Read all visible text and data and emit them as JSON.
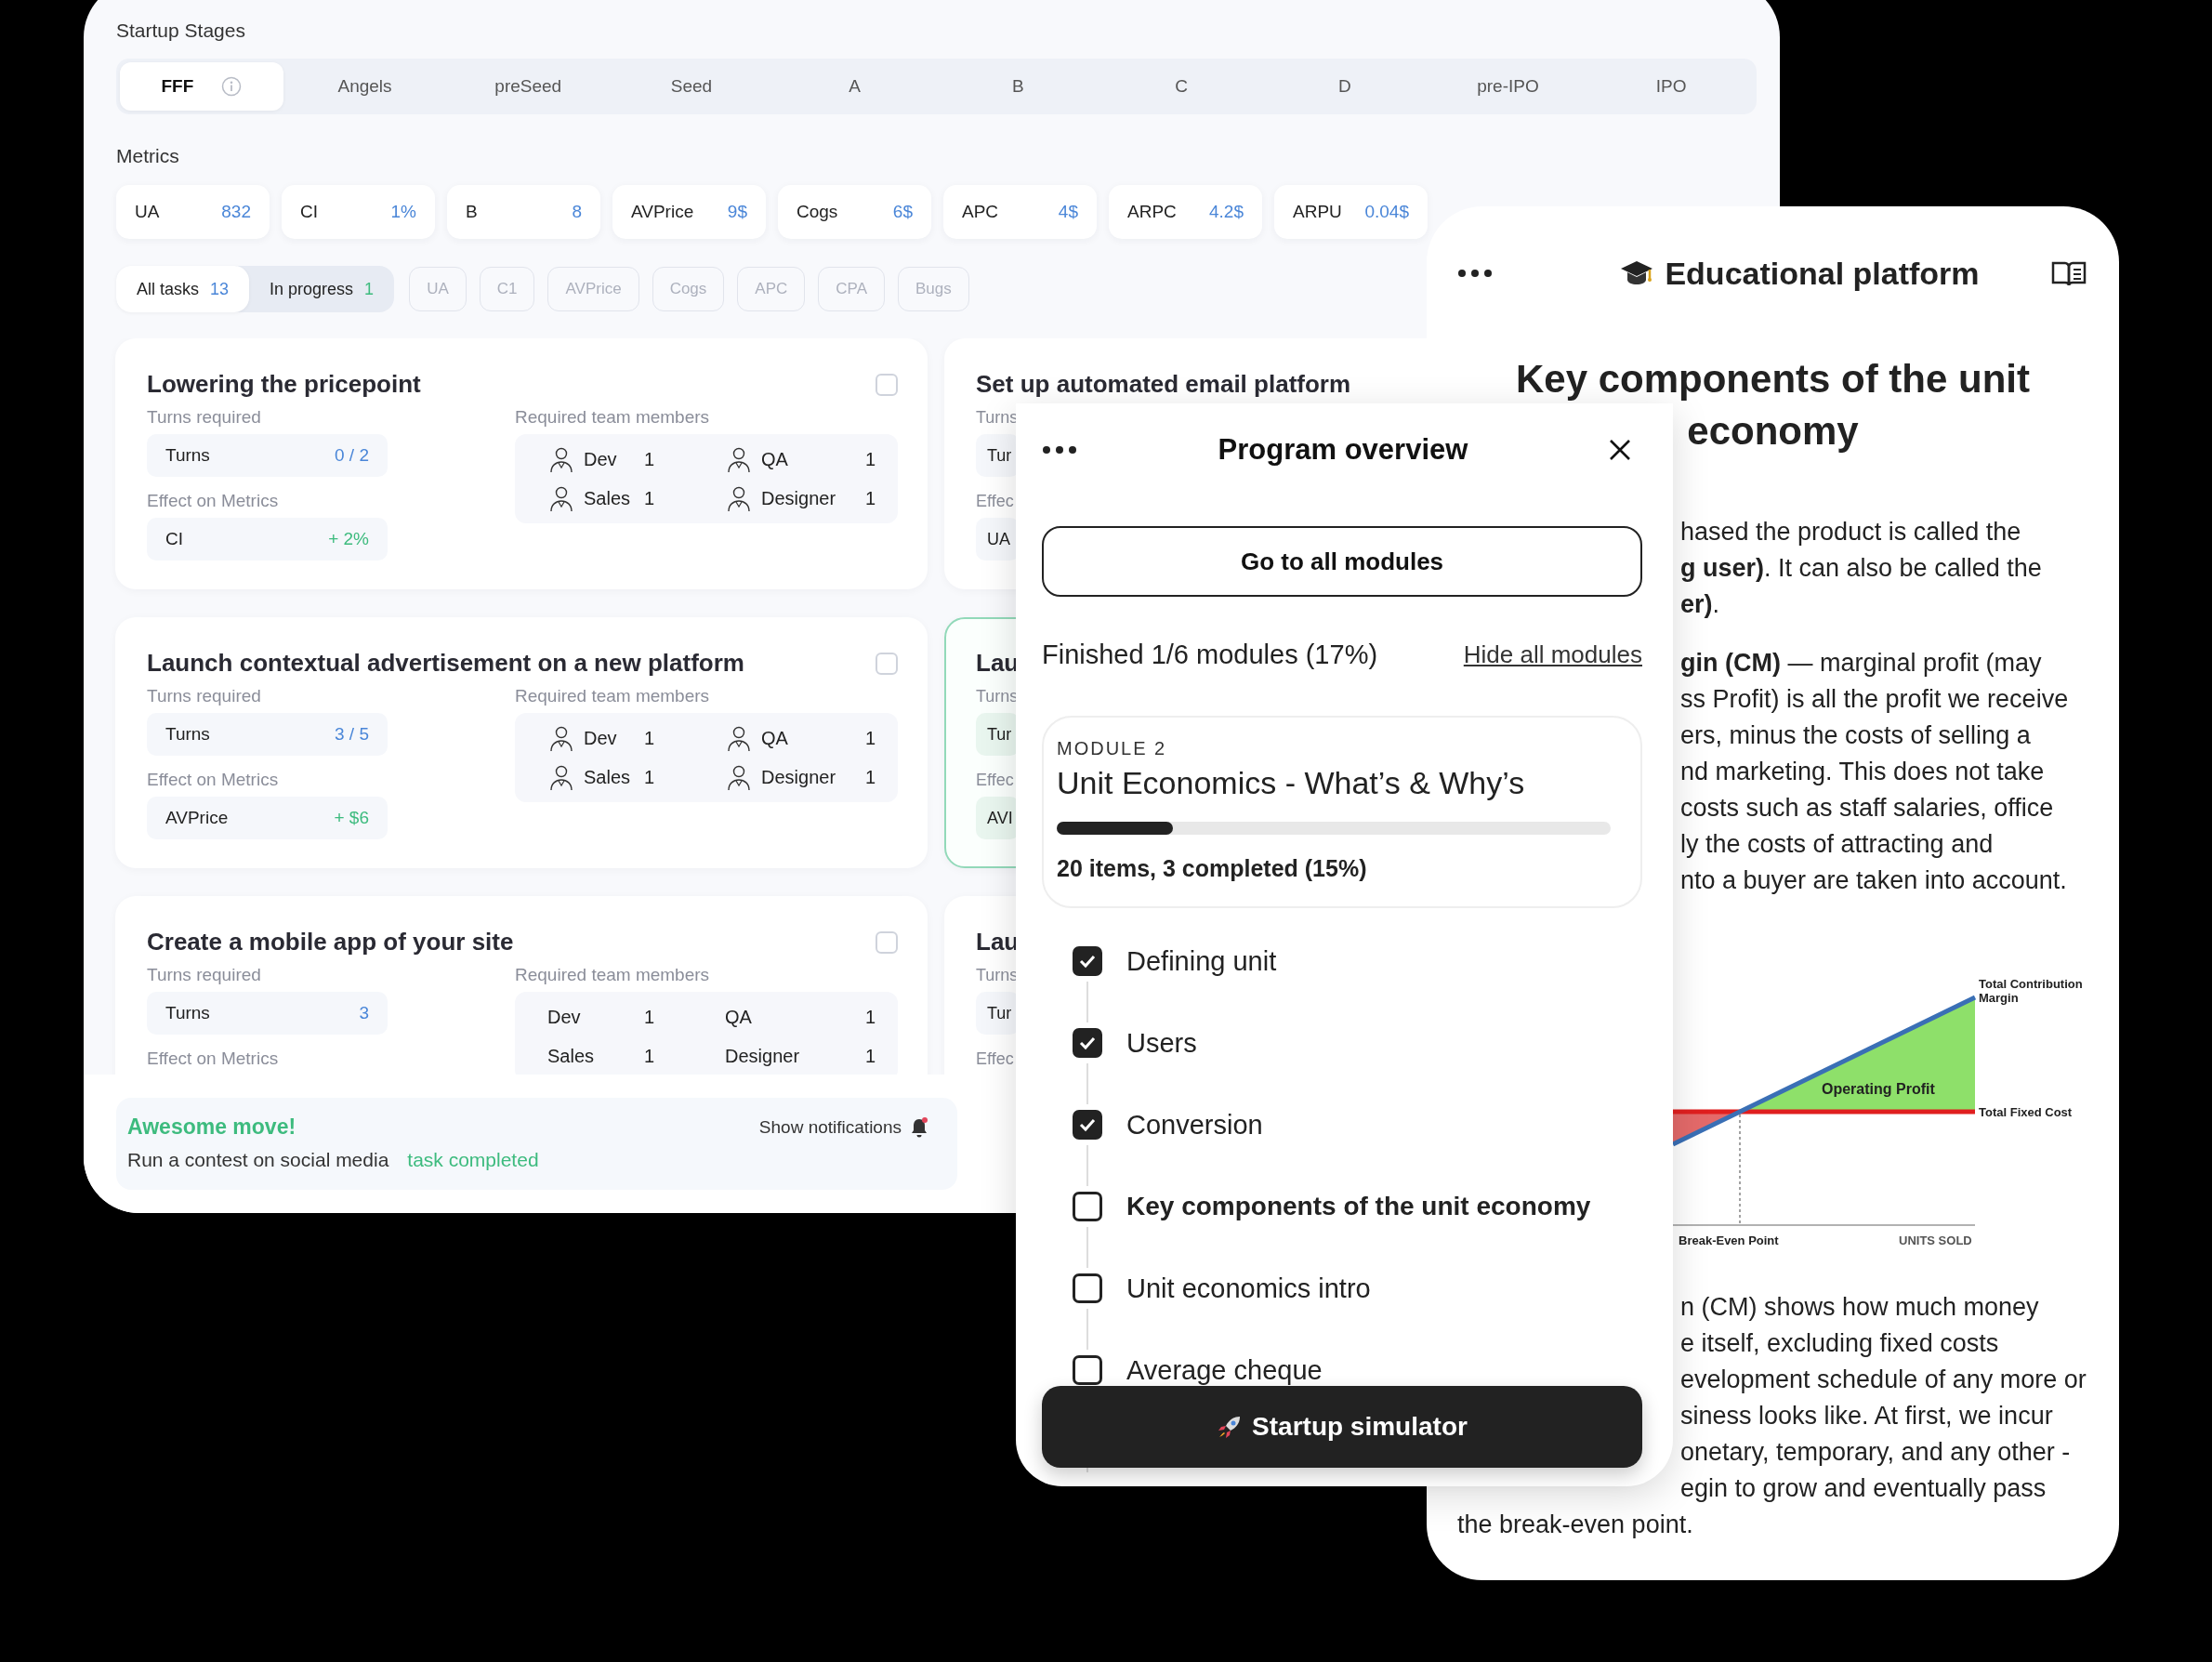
{
  "dashboard": {
    "stages_label": "Startup Stages",
    "stages": [
      {
        "label": "FFF",
        "selected": true
      },
      {
        "label": "Angels",
        "selected": false
      },
      {
        "label": "preSeed",
        "selected": false
      },
      {
        "label": "Seed",
        "selected": false
      },
      {
        "label": "A",
        "selected": false
      },
      {
        "label": "B",
        "selected": false
      },
      {
        "label": "C",
        "selected": false
      },
      {
        "label": "D",
        "selected": false
      },
      {
        "label": "pre-IPO",
        "selected": false
      },
      {
        "label": "IPO",
        "selected": false
      }
    ],
    "metrics_label": "Metrics",
    "metrics": [
      {
        "name": "UA",
        "value": "832"
      },
      {
        "name": "CI",
        "value": "1%"
      },
      {
        "name": "B",
        "value": "8"
      },
      {
        "name": "AVPrice",
        "value": "9$"
      },
      {
        "name": "Cogs",
        "value": "6$"
      },
      {
        "name": "APC",
        "value": "4$"
      },
      {
        "name": "ARPC",
        "value": "4.2$"
      },
      {
        "name": "ARPU",
        "value": "0.04$"
      }
    ],
    "filters": [
      {
        "kind": "counter",
        "label": "All tasks",
        "count": "13",
        "color": "#4a86d8",
        "selected": true
      },
      {
        "kind": "counter",
        "label": "In progress",
        "count": "1",
        "color": "#3dbb7e",
        "selected": false
      },
      {
        "kind": "tag",
        "label": "UA"
      },
      {
        "kind": "tag",
        "label": "C1"
      },
      {
        "kind": "tag",
        "label": "AVPrice"
      },
      {
        "kind": "tag",
        "label": "Cogs"
      },
      {
        "kind": "tag",
        "label": "APC"
      },
      {
        "kind": "tag",
        "label": "CPA"
      },
      {
        "kind": "tag",
        "label": "Bugs"
      }
    ],
    "tasks": [
      {
        "title": "Lowering the pricepoint",
        "checked": false,
        "highlighted": false,
        "turns_label": "Turns required",
        "turns_name": "Turns",
        "turns": "0 / 2",
        "effect_label": "Effect on Metrics",
        "metric": "CI",
        "effect": "+ 2%",
        "members_label": "Required team members",
        "members": [
          {
            "role": "Dev",
            "count": "1",
            "icon": true
          },
          {
            "role": "QA",
            "count": "1",
            "icon": true
          },
          {
            "role": "Sales",
            "count": "1",
            "icon": true
          },
          {
            "role": "Designer",
            "count": "1",
            "icon": true
          }
        ]
      },
      {
        "title": "Launch contextual advertisement on a new platform",
        "checked": false,
        "highlighted": false,
        "turns_label": "Turns required",
        "turns_name": "Turns",
        "turns": "3 / 5",
        "effect_label": "Effect on Metrics",
        "metric": "AVPrice",
        "effect": "+ $6",
        "members_label": "Required team members",
        "members": [
          {
            "role": "Dev",
            "count": "1",
            "icon": true
          },
          {
            "role": "QA",
            "count": "1",
            "icon": true
          },
          {
            "role": "Sales",
            "count": "1",
            "icon": true
          },
          {
            "role": "Designer",
            "count": "1",
            "icon": true
          }
        ]
      },
      {
        "title": "Create a mobile app of your site",
        "checked": false,
        "highlighted": false,
        "turns_label": "Turns required",
        "turns_name": "Turns",
        "turns": "3",
        "effect_label": "Effect on Metrics",
        "members_label": "Required team members",
        "members": [
          {
            "role": "Dev",
            "count": "1",
            "icon": false
          },
          {
            "role": "QA",
            "count": "1",
            "icon": false
          },
          {
            "role": "Sales",
            "count": "1",
            "icon": false
          },
          {
            "role": "Designer",
            "count": "1",
            "icon": false
          }
        ]
      }
    ],
    "tasks_right": [
      {
        "title": "Set up automated email platform",
        "highlighted": false,
        "turns_label": "Turns",
        "turns_name": "Tur",
        "effect_label": "Effec",
        "metric": "UA"
      },
      {
        "title": "Lau",
        "highlighted": true,
        "turns_label": "Turns",
        "turns_name": "Tur",
        "effect_label": "Effec",
        "metric": "AVI"
      },
      {
        "title": "Lau",
        "highlighted": false,
        "turns_label": "Turns",
        "turns_name": "Tur",
        "effect_label": "Effec"
      }
    ],
    "notification": {
      "title": "Awesome move!",
      "button": "Show notifications",
      "task": "Run a contest on social media",
      "status": "task completed"
    }
  },
  "program": {
    "title": "Program overview",
    "button": "Go to all modules",
    "progress": "Finished 1/6 modules (17%)",
    "link": "Hide all modules",
    "module": {
      "label": "MODULE 2",
      "title": "Unit Economics - What’s & Why’s",
      "level": 0.21,
      "summary": "20 items, 3 completed (15%)"
    },
    "lessons": [
      {
        "title": "Defining unit",
        "checked": true,
        "current": false
      },
      {
        "title": "Users",
        "checked": true,
        "current": false
      },
      {
        "title": "Conversion",
        "checked": true,
        "current": false
      },
      {
        "title": "Key components of the unit economy",
        "checked": false,
        "current": true
      },
      {
        "title": "Unit economics intro",
        "checked": false,
        "current": false
      },
      {
        "title": "Average cheque",
        "checked": false,
        "current": false
      }
    ],
    "action": "Startup simulator"
  },
  "education": {
    "title": "Educational platform",
    "heading": [
      "Key components of the unit",
      "economy"
    ],
    "paragraphs_top": [
      [
        "hased the product is called the",
        "**g user)**. It can also be called the",
        "**er)**."
      ],
      [
        "**gin (CM)** — marginal profit (may",
        "ss Profit) is all the profit we receive",
        "ers, minus the costs of selling a",
        "nd marketing. This does not take",
        "costs such as staff salaries, office",
        "ly the costs of attracting and",
        "nto a buyer are taken into account."
      ]
    ],
    "chart_labels": {
      "contribution": "Total Contribution Margin",
      "profit": "Operating Profit",
      "fixed_cost": "Total Fixed Cost",
      "break_even": "Break-Even Point",
      "x_axis": "UNITS SOLD"
    },
    "lines_bottom": [
      "n (CM) shows how much money",
      "e itself, excluding fixed costs",
      "evelopment schedule of any more or",
      "siness looks like. At first, we incur",
      "onetary, temporary, and any other -",
      "egin to grow and eventually pass"
    ],
    "closing": "the break-even point."
  }
}
